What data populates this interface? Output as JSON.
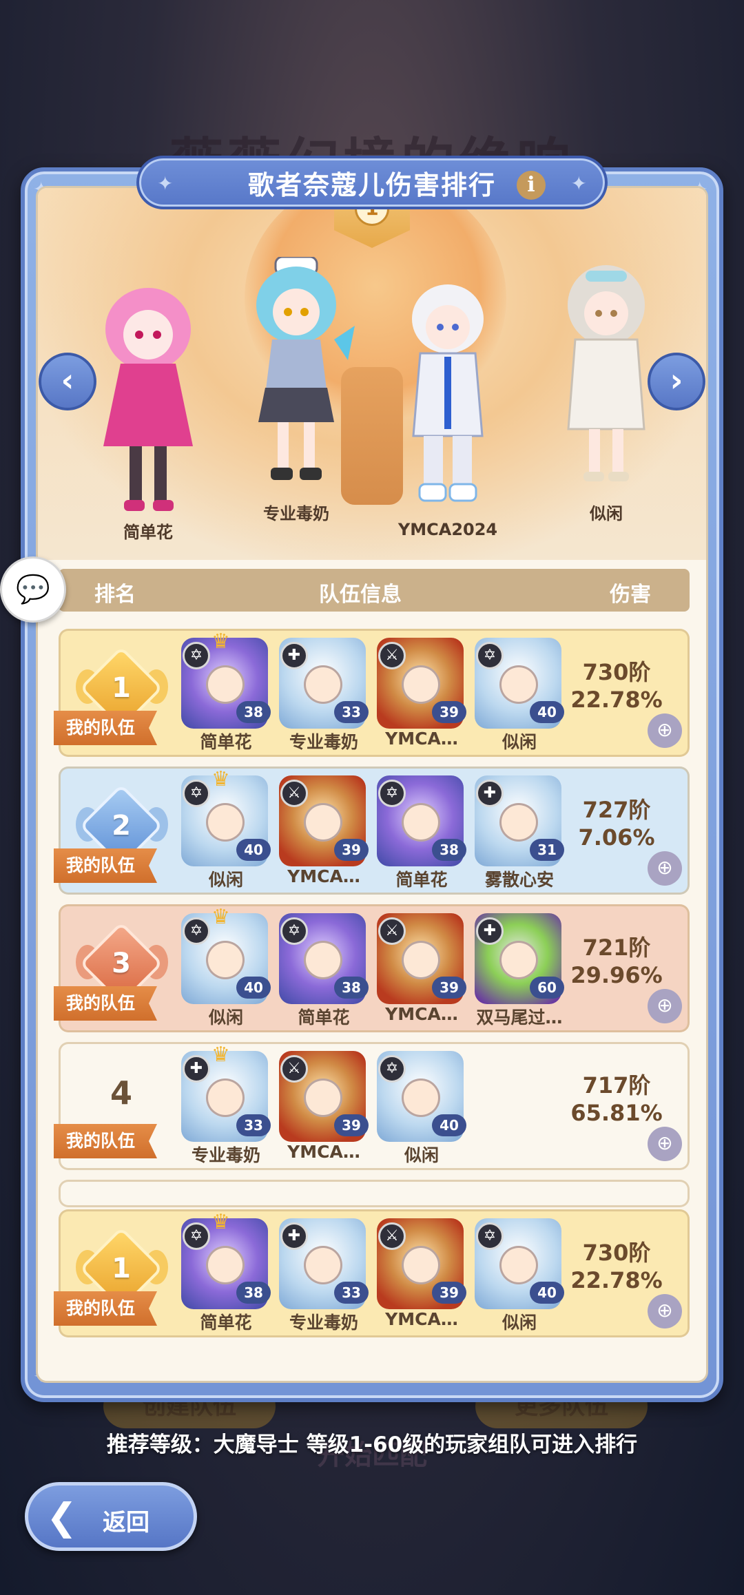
{
  "background": {
    "event_title": "薇薇幻境的绝响",
    "create_team_label": "创建队伍",
    "more_teams_label": "更多队伍",
    "start_match_label": "开始匹配"
  },
  "panel": {
    "title": "歌者奈蔻儿伤害排行",
    "info_glyph": "i",
    "banner_rank": "1"
  },
  "stage": {
    "characters": [
      {
        "name": "简单花"
      },
      {
        "name": "专业毒奶"
      },
      {
        "name": "YMCA2024"
      },
      {
        "name": "似闲"
      }
    ],
    "prev_glyph": "‹",
    "next_glyph": "›"
  },
  "table": {
    "headers": {
      "rank": "排名",
      "team": "队伍信息",
      "damage": "伤害"
    },
    "my_team_label": "我的队伍",
    "rows": [
      {
        "rank": "1",
        "style": "gold",
        "members": [
          {
            "name": "简单花",
            "level": "38",
            "crown": true,
            "tone": "purple",
            "class": "hex"
          },
          {
            "name": "专业毒奶",
            "level": "33",
            "crown": false,
            "tone": "blue",
            "class": "cross"
          },
          {
            "name": "YMCA…",
            "level": "39",
            "crown": false,
            "tone": "fire",
            "class": "sword"
          },
          {
            "name": "似闲",
            "level": "40",
            "crown": false,
            "tone": "blue",
            "class": "hex"
          }
        ],
        "damage_tier": "730阶",
        "damage_pct": "22.78%"
      },
      {
        "rank": "2",
        "style": "blue",
        "members": [
          {
            "name": "似闲",
            "level": "40",
            "crown": true,
            "tone": "blue",
            "class": "hex"
          },
          {
            "name": "YMCA…",
            "level": "39",
            "crown": false,
            "tone": "fire",
            "class": "sword"
          },
          {
            "name": "简单花",
            "level": "38",
            "crown": false,
            "tone": "purple",
            "class": "hex"
          },
          {
            "name": "雾散心安",
            "level": "31",
            "crown": false,
            "tone": "blue",
            "class": "cross"
          }
        ],
        "damage_tier": "727阶",
        "damage_pct": "7.06%"
      },
      {
        "rank": "3",
        "style": "bronze",
        "members": [
          {
            "name": "似闲",
            "level": "40",
            "crown": true,
            "tone": "blue",
            "class": "hex"
          },
          {
            "name": "简单花",
            "level": "38",
            "crown": false,
            "tone": "purple",
            "class": "hex"
          },
          {
            "name": "YMCA…",
            "level": "39",
            "crown": false,
            "tone": "fire",
            "class": "sword"
          },
          {
            "name": "双马尾过…",
            "level": "60",
            "crown": false,
            "tone": "green",
            "class": "cross"
          }
        ],
        "damage_tier": "721阶",
        "damage_pct": "29.96%"
      },
      {
        "rank": "4",
        "style": "plain",
        "members": [
          {
            "name": "专业毒奶",
            "level": "33",
            "crown": true,
            "tone": "blue",
            "class": "cross"
          },
          {
            "name": "YMCA…",
            "level": "39",
            "crown": false,
            "tone": "fire",
            "class": "sword"
          },
          {
            "name": "似闲",
            "level": "40",
            "crown": false,
            "tone": "blue",
            "class": "hex"
          }
        ],
        "damage_tier": "717阶",
        "damage_pct": "65.81%"
      }
    ],
    "pinned": {
      "rank": "1",
      "style": "gold",
      "members": [
        {
          "name": "简单花",
          "level": "38",
          "crown": true,
          "tone": "purple",
          "class": "hex"
        },
        {
          "name": "专业毒奶",
          "level": "33",
          "crown": false,
          "tone": "blue",
          "class": "cross"
        },
        {
          "name": "YMCA…",
          "level": "39",
          "crown": false,
          "tone": "fire",
          "class": "sword"
        },
        {
          "name": "似闲",
          "level": "40",
          "crown": false,
          "tone": "blue",
          "class": "hex"
        }
      ],
      "damage_tier": "730阶",
      "damage_pct": "22.78%"
    }
  },
  "icons": {
    "zoom": "zoom-in-icon",
    "chat": "chat-bubble-icon",
    "back": "chevron-left-icon"
  },
  "footer": {
    "recommend": "推荐等级：大魔导士  等级1-60级的玩家组队可进入排行",
    "back_label": "返回"
  },
  "colors": {
    "panel_blue": "#7394d6",
    "gold_row": "#fbe9b2",
    "blue_row": "#d6e8f6",
    "bronze_row": "#f5d4c2",
    "tag_orange": "#d06f2c"
  }
}
